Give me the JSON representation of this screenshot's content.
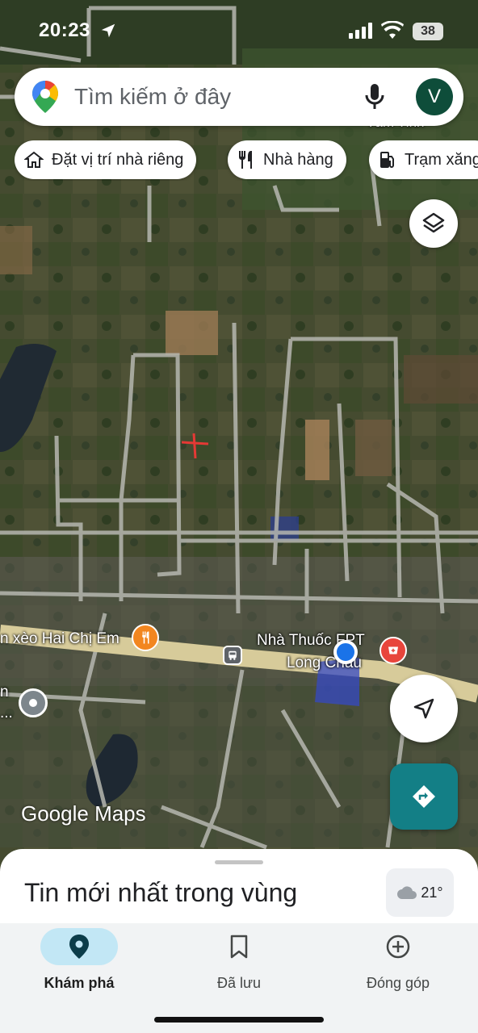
{
  "status_bar": {
    "time": "20:23",
    "battery": "38"
  },
  "search": {
    "placeholder": "Tìm kiếm ở đây",
    "avatar_letter": "V"
  },
  "chips": [
    {
      "label": "Đặt vị trí nhà riêng",
      "icon": "home-icon"
    },
    {
      "label": "Nhà hàng",
      "icon": "restaurant-icon"
    },
    {
      "label": "Trạm xăng",
      "icon": "gas-station-icon"
    }
  ],
  "map": {
    "place_labels": {
      "restaurant": "n xèo Hai Chị Em",
      "pharmacy_line1": "Nhà Thuốc FPT",
      "pharmacy_line2": "Long Châu",
      "left_poi_line1": "n",
      "left_poi_line2": "...",
      "top_partial": "Tâm Tỉnh"
    },
    "watermark": "Google Maps",
    "colors": {
      "location_dot": "#1a73e8",
      "directions": "#137f86",
      "pharmacy_badge": "#e8453c",
      "restaurant_badge": "#f2861f"
    }
  },
  "sheet": {
    "title": "Tin mới nhất trong vùng",
    "temperature": "21°"
  },
  "tabbar": {
    "tabs": [
      {
        "label": "Khám phá",
        "icon": "explore-pin-icon",
        "active": true
      },
      {
        "label": "Đã lưu",
        "icon": "bookmark-icon",
        "active": false
      },
      {
        "label": "Đóng góp",
        "icon": "add-circle-icon",
        "active": false
      }
    ]
  }
}
